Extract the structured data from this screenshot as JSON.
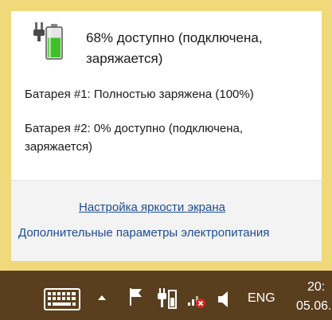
{
  "flyout": {
    "headline": "68% доступно (подключена, заряжается)",
    "charge_level": 0.68,
    "battery_1": "Батарея #1: Полностью заряжена (100%)",
    "battery_2": "Батарея #2: 0% доступно (подключена, заряжается)",
    "links": {
      "brightness": "Настройка яркости экрана",
      "power_options": "Дополнительные параметры электропитания"
    }
  },
  "taskbar": {
    "language": "ENG",
    "clock_time": "20:",
    "clock_date": "05.06.",
    "icons": [
      "keyboard-icon",
      "chevron-up-icon",
      "flag-icon",
      "power-plug-icon",
      "network-disconnected-icon",
      "speaker-icon"
    ]
  },
  "colors": {
    "accent": "#f0d97a",
    "link": "#1c4c96",
    "taskbar": "#5a3f1f",
    "battery_fill": "#3fbf2a"
  }
}
